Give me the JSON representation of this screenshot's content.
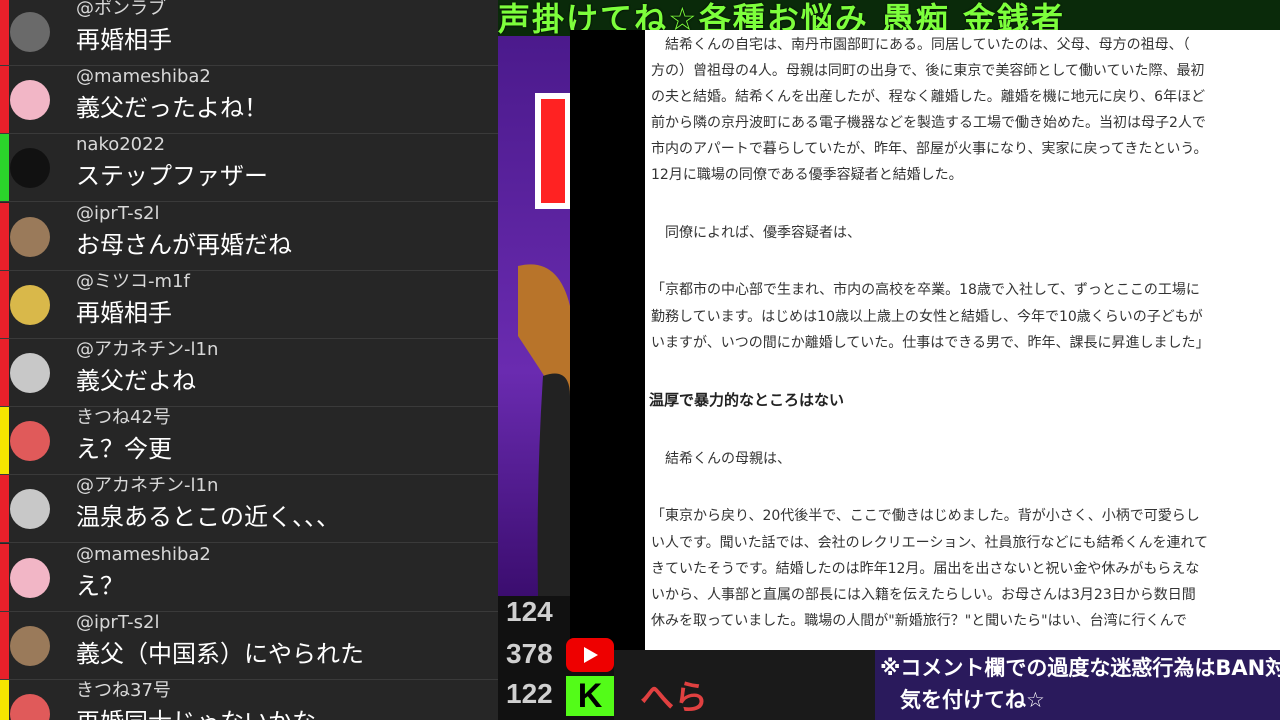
{
  "banner": {
    "text": "声掛けてね☆各種お悩み 愚痴 金銭者"
  },
  "chat": [
    {
      "user": "@ポンラブ",
      "message": "再婚相手",
      "stripe": "#e8202a",
      "avatar": "#6a6a6a"
    },
    {
      "user": "@mameshiba2",
      "message": "義父だったよね！",
      "stripe": "#e8202a",
      "avatar": "#f2b6c6"
    },
    {
      "user": "nako2022",
      "message": "ステップファザー",
      "stripe": "#2bd42b",
      "avatar": "#111111"
    },
    {
      "user": "@iprT-s2l",
      "message": "お母さんが再婚だね",
      "stripe": "#e8202a",
      "avatar": "#9a7a5a"
    },
    {
      "user": "@ミツコ-m1f",
      "message": "再婚相手",
      "stripe": "#e8202a",
      "avatar": "#d9b84a"
    },
    {
      "user": "@アカネチン-l1n",
      "message": "義父だよね",
      "stripe": "#e8202a",
      "avatar": "#c8c8c8"
    },
    {
      "user": "きつね42号",
      "message": "え？今更",
      "stripe": "#f5e600",
      "avatar": "#e05a5a"
    },
    {
      "user": "@アカネチン-l1n",
      "message": "温泉あるとこの近く、、、",
      "stripe": "#e8202a",
      "avatar": "#c8c8c8"
    },
    {
      "user": "@mameshiba2",
      "message": "え？",
      "stripe": "#e8202a",
      "avatar": "#f2b6c6"
    },
    {
      "user": "@iprT-s2l",
      "message": "義父（中国系）にやられた",
      "stripe": "#e8202a",
      "avatar": "#9a7a5a"
    },
    {
      "user": "きつね37号",
      "message": "再婚同士じゃないかな",
      "stripe": "#f5e600",
      "avatar": "#e05a5a"
    }
  ],
  "article": {
    "lines": [
      "結希くんの自宅は、南丹市園部町にある。同居していたのは、父母、母方の祖母、（",
      "方の）曾祖母の4人。母親は同町の出身で、後に東京で美容師として働いていた際、最初",
      "の夫と結婚。結希くんを出産したが、程なく離婚した。離婚を機に地元に戻り、6年ほど",
      "前から隣の京丹波町にある電子機器などを製造する工場で働き始めた。当初は母子2人で",
      "市内のアパートで暮らしていたが、昨年、部屋が火事になり、実家に戻ってきたという。",
      "12月に職場の同僚である優季容疑者と結婚した。",
      "同僚によれば、優季容疑者は、",
      "「京都市の中心部で生まれ、市内の高校を卒業。18歳で入社して、ずっとここの工場に",
      "勤務しています。はじめは10歳以上歳上の女性と結婚し、今年で10歳くらいの子どもが",
      "いますが、いつの間にか離婚していた。仕事はできる男で、昨年、課長に昇進しました」",
      "温厚で暴力的なところはない",
      "結希くんの母親は、",
      "「東京から戻り、20代後半で、ここで働きはじめました。背が小さく、小柄で可愛らし",
      "い人です。聞いた話では、会社のレクリエーション、社員旅行などにも結希くんを連れて",
      "きていたそうです。結婚したのは昨年12月。届出を出さないと祝い金や休みがもらえな",
      "いから、人事部と直属の部長には入籍を伝えたらしい。お母さんは3月23日から数日間",
      "休みを取っていました。職場の人間が\"新婚旅行？\"と聞いたら\"はい、台湾に行くんで"
    ]
  },
  "counts": {
    "youtube": "124",
    "second": "378",
    "kick": "122"
  },
  "bottom": {
    "hera": "へら",
    "notice_line1": "※コメント欄での過度な迷惑行為はBAN対象",
    "notice_line2": "気を付けてね☆"
  }
}
